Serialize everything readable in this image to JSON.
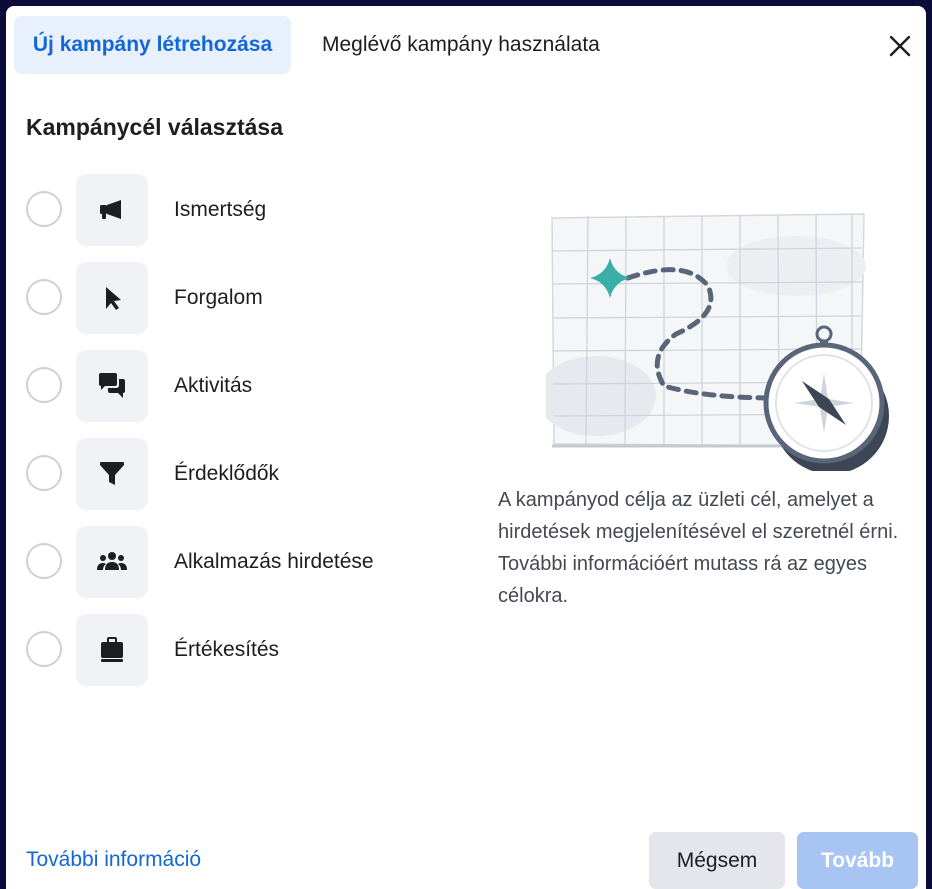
{
  "tabs": {
    "new_campaign": "Új kampány létrehozása",
    "existing_campaign": "Meglévő kampány használata"
  },
  "section_title": "Kampánycél választása",
  "objectives": [
    {
      "label": "Ismertség",
      "icon": "megaphone-icon"
    },
    {
      "label": "Forgalom",
      "icon": "cursor-icon"
    },
    {
      "label": "Aktivitás",
      "icon": "chat-bubbles-icon"
    },
    {
      "label": "Érdeklődők",
      "icon": "funnel-icon"
    },
    {
      "label": "Alkalmazás hirdetése",
      "icon": "people-icon"
    },
    {
      "label": "Értékesítés",
      "icon": "briefcase-icon"
    }
  ],
  "description": "A kampányod célja az üzleti cél, amelyet a hirdetések megjelenítésével el szeretnél érni. További információért mutass rá az egyes célokra.",
  "footer": {
    "more_info": "További információ",
    "cancel": "Mégsem",
    "next": "Tovább"
  },
  "colors": {
    "accent": "#1467d6",
    "active_tab_bg": "#e7f0fb",
    "disabled_button": "#a7c4f3",
    "star_teal": "#3aaea8",
    "outer_bg": "#0b0c3a"
  }
}
